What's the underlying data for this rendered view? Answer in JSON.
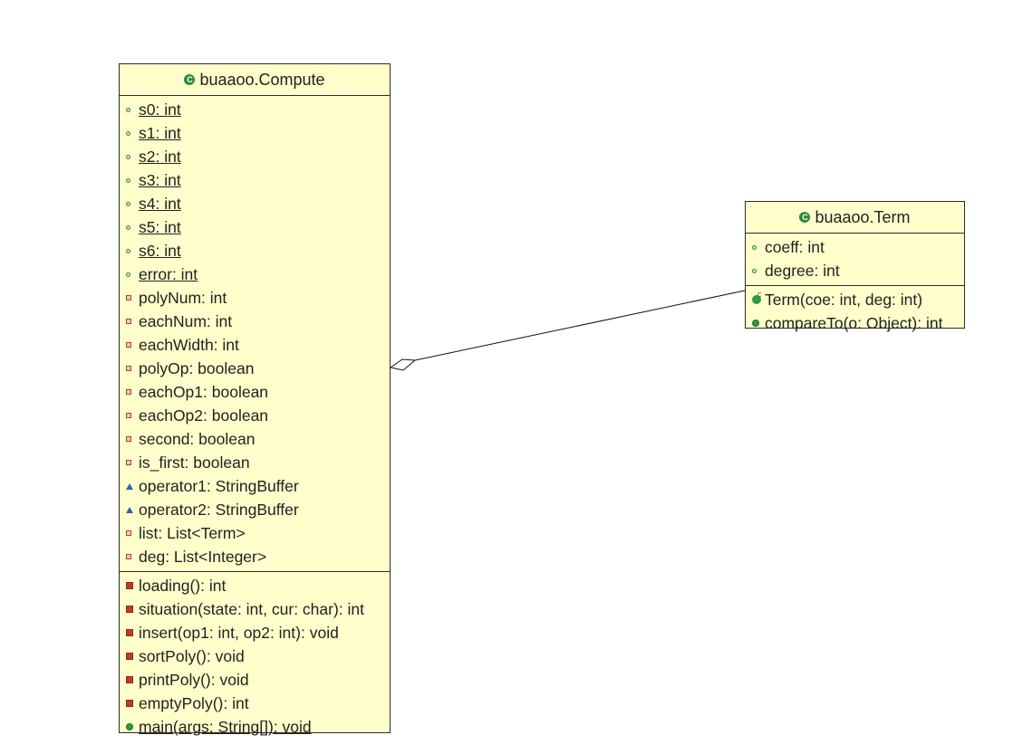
{
  "compute": {
    "title": "buaaoo.Compute",
    "fields": [
      {
        "text": "s0: int",
        "vis": "dot",
        "static": true
      },
      {
        "text": "s1: int",
        "vis": "dot",
        "static": true
      },
      {
        "text": "s2: int",
        "vis": "dot",
        "static": true
      },
      {
        "text": "s3: int",
        "vis": "dot",
        "static": true
      },
      {
        "text": "s4: int",
        "vis": "dot",
        "static": true
      },
      {
        "text": "s5: int",
        "vis": "dot",
        "static": true
      },
      {
        "text": "s6: int",
        "vis": "dot",
        "static": true
      },
      {
        "text": "error: int",
        "vis": "dot",
        "static": true
      },
      {
        "text": "polyNum: int",
        "vis": "sq",
        "static": false
      },
      {
        "text": "eachNum: int",
        "vis": "sq",
        "static": false
      },
      {
        "text": "eachWidth: int",
        "vis": "sq",
        "static": false
      },
      {
        "text": "polyOp: boolean",
        "vis": "sq",
        "static": false
      },
      {
        "text": "eachOp1: boolean",
        "vis": "sq",
        "static": false
      },
      {
        "text": "eachOp2: boolean",
        "vis": "sq",
        "static": false
      },
      {
        "text": "second: boolean",
        "vis": "sq",
        "static": false
      },
      {
        "text": "is_first: boolean",
        "vis": "sq",
        "static": false
      },
      {
        "text": "operator1: StringBuffer",
        "vis": "tri",
        "static": false
      },
      {
        "text": "operator2: StringBuffer",
        "vis": "tri",
        "static": false
      },
      {
        "text": "list: List<Term>",
        "vis": "sq",
        "static": false
      },
      {
        "text": "deg: List<Integer>",
        "vis": "sq",
        "static": false
      }
    ],
    "methods": [
      {
        "text": "loading(): int",
        "vis": "sq-m",
        "static": false
      },
      {
        "text": "situation(state: int, cur: char): int",
        "vis": "sq-m",
        "static": false
      },
      {
        "text": "insert(op1: int, op2: int): void",
        "vis": "sq-m",
        "static": false
      },
      {
        "text": "sortPoly(): void",
        "vis": "sq-m",
        "static": false
      },
      {
        "text": "printPoly(): void",
        "vis": "sq-m",
        "static": false
      },
      {
        "text": "emptyPoly(): int",
        "vis": "sq-m",
        "static": false
      },
      {
        "text": "main(args: String[]): void",
        "vis": "dot-m",
        "static": true
      }
    ]
  },
  "term": {
    "title": "buaaoo.Term",
    "fields": [
      {
        "text": "coeff: int",
        "vis": "dot",
        "static": false
      },
      {
        "text": "degree: int",
        "vis": "dot",
        "static": false
      }
    ],
    "methods": [
      {
        "text": "Term(coe: int, deg: int)",
        "vis": "ctor",
        "static": false
      },
      {
        "text": "compareTo(o: Object): int",
        "vis": "dot-m",
        "static": false
      }
    ]
  },
  "relation": {
    "type": "aggregation",
    "from": "buaaoo.Compute",
    "to": "buaaoo.Term"
  },
  "colors": {
    "class_fill": "#ffffcc",
    "border": "#2b2b2b",
    "public": "#2f8a3a",
    "private": "#c0392b",
    "package": "#2b62a8"
  },
  "icons": {
    "class": "class-icon"
  }
}
